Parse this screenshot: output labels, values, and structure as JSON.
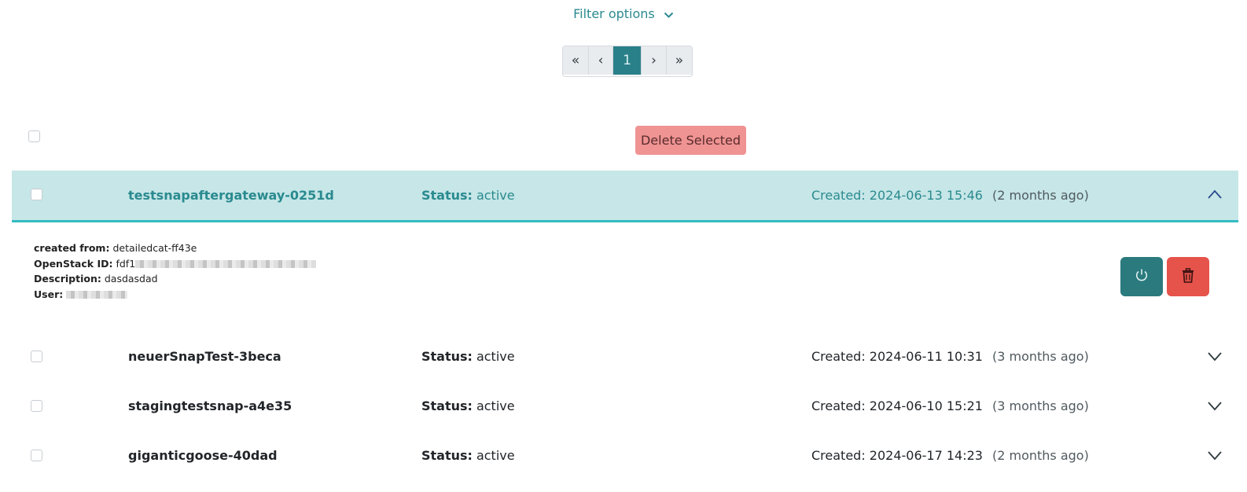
{
  "filter": {
    "label": "Filter options"
  },
  "pagination": {
    "first": "«",
    "prev": "‹",
    "current": "1",
    "next": "›",
    "last": "»"
  },
  "toolbar": {
    "delete_selected_label": "Delete Selected"
  },
  "colors": {
    "accent": "#2a8089",
    "expanded_bg": "#c6e6e7",
    "danger": "#e5534b",
    "danger_light": "#ef9393"
  },
  "snapshots": [
    {
      "name": "testsnapaftergateway-0251d",
      "status_label": "Status:",
      "status": "active",
      "created": "Created: 2024-06-13 15:46",
      "ago": "(2 months ago)",
      "expanded": true,
      "details": {
        "created_from_label": "created from:",
        "created_from": "detailedcat-ff43e",
        "openstack_id_label": "OpenStack ID:",
        "openstack_id": "fdf1",
        "description_label": "Description:",
        "description": "dasdasdad",
        "user_label": "User:"
      }
    },
    {
      "name": "neuerSnapTest-3beca",
      "status_label": "Status:",
      "status": "active",
      "created": "Created: 2024-06-11 10:31",
      "ago": "(3 months ago)",
      "expanded": false
    },
    {
      "name": "stagingtestsnap-a4e35",
      "status_label": "Status:",
      "status": "active",
      "created": "Created: 2024-06-10 15:21",
      "ago": "(3 months ago)",
      "expanded": false
    },
    {
      "name": "giganticgoose-40dad",
      "status_label": "Status:",
      "status": "active",
      "created": "Created: 2024-06-17 14:23",
      "ago": "(2 months ago)",
      "expanded": false
    }
  ],
  "icons": {
    "filter_chevron": "chevron-down-icon",
    "collapse": "chevron-up-icon",
    "expand": "chevron-down-icon",
    "power": "power-icon",
    "trash": "trash-icon"
  }
}
